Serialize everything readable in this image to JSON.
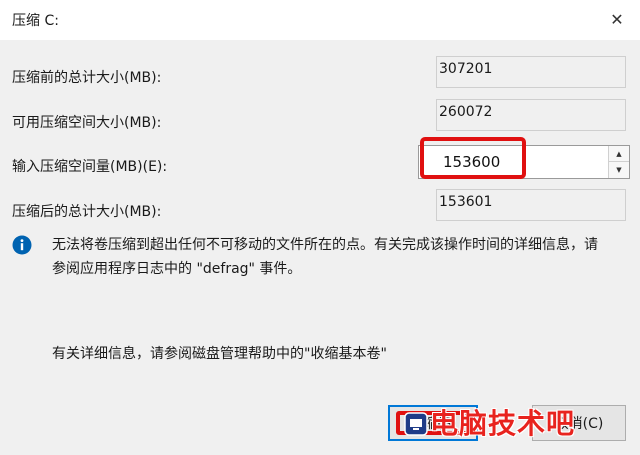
{
  "window": {
    "title": "压缩 C:",
    "close_glyph": "✕"
  },
  "fields": {
    "total_before": {
      "label": "压缩前的总计大小(MB):",
      "value": "307201"
    },
    "available": {
      "label": "可用压缩空间大小(MB):",
      "value": "260072"
    },
    "shrink_amount": {
      "label": "输入压缩空间量(MB)(E):",
      "value": "153600"
    },
    "total_after": {
      "label": "压缩后的总计大小(MB):",
      "value": "153601"
    }
  },
  "spin": {
    "up_glyph": "▲",
    "down_glyph": "▼"
  },
  "info": {
    "line1": "无法将卷压缩到超出任何不可移动的文件所在的点。有关完成该操作时间的详细信息，请",
    "line2": "参阅应用程序日志中的 \"defrag\" 事件。"
  },
  "help": "有关详细信息，请参阅磁盘管理帮助中的\"收缩基本卷\"",
  "buttons": {
    "shrink": "压缩(S)",
    "cancel": "取消(C)"
  },
  "watermark": "电脑技术吧",
  "colors": {
    "highlight": "#e01010",
    "focus_border": "#0078d7",
    "info_icon": "#0063b1",
    "watermark": "#e8231e"
  }
}
